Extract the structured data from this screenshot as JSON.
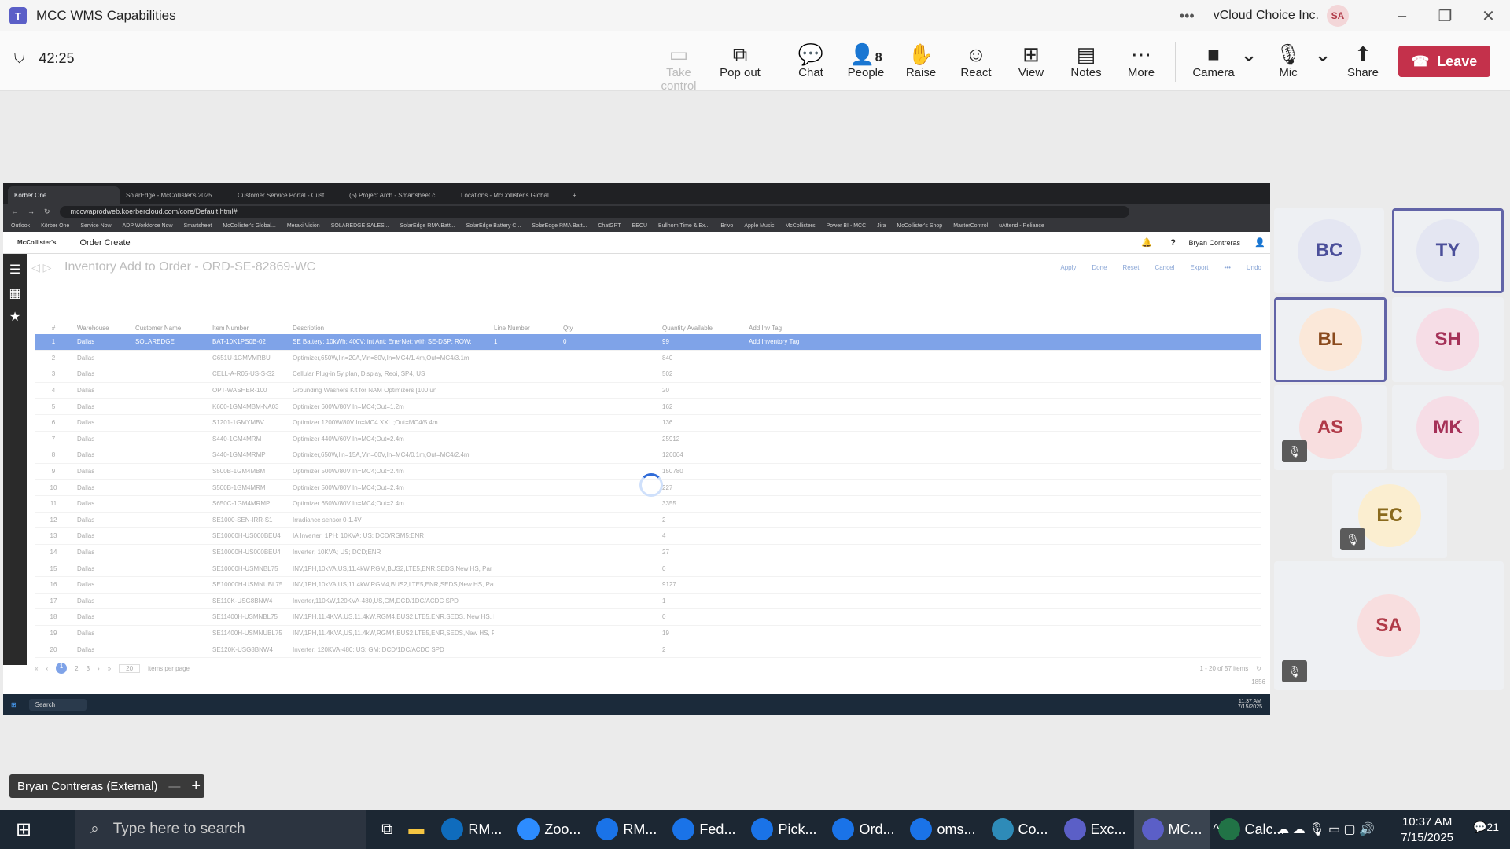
{
  "window": {
    "title": "MCC WMS Capabilities",
    "org": "vCloud Choice Inc.",
    "user_initials": "SA"
  },
  "meeting": {
    "timer": "42:25",
    "toolbar": [
      {
        "label": "Take control",
        "icon": "take-control-icon",
        "disabled": true
      },
      {
        "label": "Pop out",
        "icon": "pop-out-icon"
      },
      {
        "label": "Chat",
        "icon": "chat-icon"
      },
      {
        "label": "People",
        "icon": "people-icon",
        "count": "8"
      },
      {
        "label": "Raise",
        "icon": "raise-hand-icon"
      },
      {
        "label": "React",
        "icon": "react-icon"
      },
      {
        "label": "View",
        "icon": "view-icon"
      },
      {
        "label": "Notes",
        "icon": "notes-icon"
      },
      {
        "label": "More",
        "icon": "more-icon"
      },
      {
        "label": "Camera",
        "icon": "camera-off-icon"
      },
      {
        "label": "Mic",
        "icon": "mic-off-icon"
      },
      {
        "label": "Share",
        "icon": "share-icon"
      }
    ],
    "leave_label": "Leave"
  },
  "shared": {
    "tabs": [
      "Körber One",
      "SolarEdge - McCollister's 2025",
      "Customer Service Portal - Cust",
      "(5) Project Arch - Smartsheet.c",
      "Locations - McCollister's Global"
    ],
    "url": "mccwaprodweb.koerbercloud.com/core/Default.html#",
    "bookmarks": [
      "Outlook",
      "Körber One",
      "Service Now",
      "ADP Workforce Now",
      "Smartsheet",
      "McCollister's Global...",
      "Meraki Vision",
      "SOLAREDGE SALES...",
      "SolarEdge RMA Batt...",
      "SolarEdge Battery C...",
      "SolarEdge RMA Batt...",
      "ChatGPT",
      "EECU",
      "Bullhorn Time & Ex...",
      "Brivo",
      "Apple Music",
      "McCollisters",
      "Power BI - MCC",
      "Jira",
      "McCollister's Shop",
      "MasterControl",
      "uAttend - Reliance"
    ],
    "app_brand": "McCollister's",
    "app_title": "Order Create",
    "app_user": "Bryan Contreras",
    "screen_title": "Inventory Add to Order - ORD-SE-82869-WC",
    "actions": [
      "Apply",
      "Done",
      "Reset",
      "Cancel",
      "Export",
      "•••",
      "Undo"
    ],
    "columns": [
      "#",
      "Warehouse",
      "Customer Name",
      "Item Number",
      "Description",
      "Line Number",
      "Qty",
      "Quantity Available",
      "Add Inv Tag"
    ],
    "rows": [
      [
        "1",
        "Dallas",
        "SOLAREDGE",
        "BAT-10K1PS0B-02",
        "SE Battery; 10kWh; 400V; int Ant; EnerNet; with SE-DSP; ROW;",
        "1",
        "0",
        "99",
        "Add Inventory Tag"
      ],
      [
        "2",
        "Dallas",
        "",
        "C651U-1GMVMRBU",
        "Optimizer,650W,lin=20A,Vin=80V,In=MC4/1.4m,Out=MC4/3.1m",
        "",
        "",
        "840",
        ""
      ],
      [
        "3",
        "Dallas",
        "",
        "CELL-A-R05-US-S-S2",
        "Cellular Plug-in 5y plan, Display, Reoi, SP4, US",
        "",
        "",
        "502",
        ""
      ],
      [
        "4",
        "Dallas",
        "",
        "OPT-WASHER-100",
        "Grounding Washers Kit for NAM Optimizers [100 un",
        "",
        "",
        "20",
        ""
      ],
      [
        "5",
        "Dallas",
        "",
        "K600-1GM4MBM-NA03",
        "Optimizer 600W/80V In=MC4;Out=1.2m",
        "",
        "",
        "162",
        ""
      ],
      [
        "6",
        "Dallas",
        "",
        "S1201-1GMYMBV",
        "Optimizer 1200W/80V In=MC4 XXL ;Out=MC4/5.4m",
        "",
        "",
        "136",
        ""
      ],
      [
        "7",
        "Dallas",
        "",
        "S440-1GM4MRM",
        "Optimizer 440W/60V In=MC4;Out=2.4m",
        "",
        "",
        "25912",
        ""
      ],
      [
        "8",
        "Dallas",
        "",
        "S440-1GM4MRMP",
        "Optimizer,650W,lin=15A,Vin=60V,In=MC4/0.1m,Out=MC4/2.4m",
        "",
        "",
        "126064",
        ""
      ],
      [
        "9",
        "Dallas",
        "",
        "S500B-1GM4MBM",
        "Optimizer 500W/80V In=MC4;Out=2.4m",
        "",
        "",
        "150780",
        ""
      ],
      [
        "10",
        "Dallas",
        "",
        "S500B-1GM4MRM",
        "Optimizer 500W/80V In=MC4;Out=2.4m",
        "",
        "",
        "227",
        ""
      ],
      [
        "11",
        "Dallas",
        "",
        "S650C-1GM4MRMP",
        "Optimizer 650W/80V In=MC4;Out=2.4m",
        "",
        "",
        "3355",
        ""
      ],
      [
        "12",
        "Dallas",
        "",
        "SE1000-SEN-IRR-S1",
        "Irradiance sensor 0-1.4V",
        "",
        "",
        "2",
        ""
      ],
      [
        "13",
        "Dallas",
        "",
        "SE10000H-US000BEU4",
        "IA Inverter; 1PH; 10KVA; US; DCD/RGM5;ENR",
        "",
        "",
        "4",
        ""
      ],
      [
        "14",
        "Dallas",
        "",
        "SE10000H-US000BEU4",
        "Inverter; 10KVA; US; DCD;ENR",
        "",
        "",
        "27",
        ""
      ],
      [
        "15",
        "Dallas",
        "",
        "SE10000H-USMNBL75",
        "INV,1PH,10kVA,US,11.4kW,RGM,BUS2,LTE5,ENR,SEDS,New HS, Par",
        "",
        "",
        "0",
        ""
      ],
      [
        "16",
        "Dallas",
        "",
        "SE10000H-USMNUBL75",
        "INV,1PH,10kVA,US,11.4kW,RGM4,BUS2,LTE5,ENR,SEDS,New HS, Part",
        "",
        "",
        "9127",
        ""
      ],
      [
        "17",
        "Dallas",
        "",
        "SE110K-USG8BNW4",
        "Inverter,110KW,120KVA-480,US,GM,DCD/1DC/ACDC SPD",
        "",
        "",
        "1",
        ""
      ],
      [
        "18",
        "Dallas",
        "",
        "SE11400H-USMNBL75",
        "INV,1PH,11.4KVA,US,11.4kW,RGM4,BUS2,LTE5,ENR,SEDS, New HS, P",
        "",
        "",
        "0",
        ""
      ],
      [
        "19",
        "Dallas",
        "",
        "SE11400H-USMNUBL75",
        "INV,1PH,11.4KVA,US,11.4kW,RGM4,BUS2,LTE5,ENR,SEDS,New HS, Pa",
        "",
        "",
        "19",
        ""
      ],
      [
        "20",
        "Dallas",
        "",
        "SE120K-USG8BNW4",
        "Inverter; 120KVA-480; US; GM; DCD/1DC/ACDC SPD",
        "",
        "",
        "2",
        ""
      ]
    ],
    "pager": {
      "pages": [
        "1",
        "2",
        "3"
      ],
      "per_page": "20",
      "per_page_label": "items per page",
      "range": "1 - 20 of 57 items",
      "counter": "1856"
    },
    "win_search": "Search",
    "win_time": "11:37 AM",
    "win_date": "7/15/2025"
  },
  "participants": [
    {
      "initials": "BC",
      "bg": "#e4e6f2",
      "fg": "#4b4f9a"
    },
    {
      "initials": "TY",
      "bg": "#e4e6f2",
      "fg": "#4b4f9a",
      "speaking": true
    },
    {
      "initials": "BL",
      "bg": "#fbe8d9",
      "fg": "#8a4a1d",
      "speaking": true
    },
    {
      "initials": "SH",
      "bg": "#f6dde6",
      "fg": "#a53158"
    },
    {
      "initials": "AS",
      "bg": "#f8dedf",
      "fg": "#b03a48",
      "muted": true
    },
    {
      "initials": "MK",
      "bg": "#f6dde6",
      "fg": "#a53158"
    },
    {
      "initials": "EC",
      "bg": "#fbeed0",
      "fg": "#8a6a1d",
      "muted": true
    },
    {
      "initials": "SA",
      "bg": "#f8dedf",
      "fg": "#b03a48",
      "muted": true
    }
  ],
  "presenter": {
    "name": "Bryan Contreras (External)"
  },
  "taskbar": {
    "search_placeholder": "Type here to search",
    "apps": [
      "RM...",
      "Zoo...",
      "RM...",
      "Fed...",
      "Pick...",
      "Ord...",
      "oms...",
      "Co...",
      "Exc...",
      "MC...",
      "Calc..."
    ],
    "time": "10:37 AM",
    "date": "7/15/2025",
    "notifications": "21"
  }
}
